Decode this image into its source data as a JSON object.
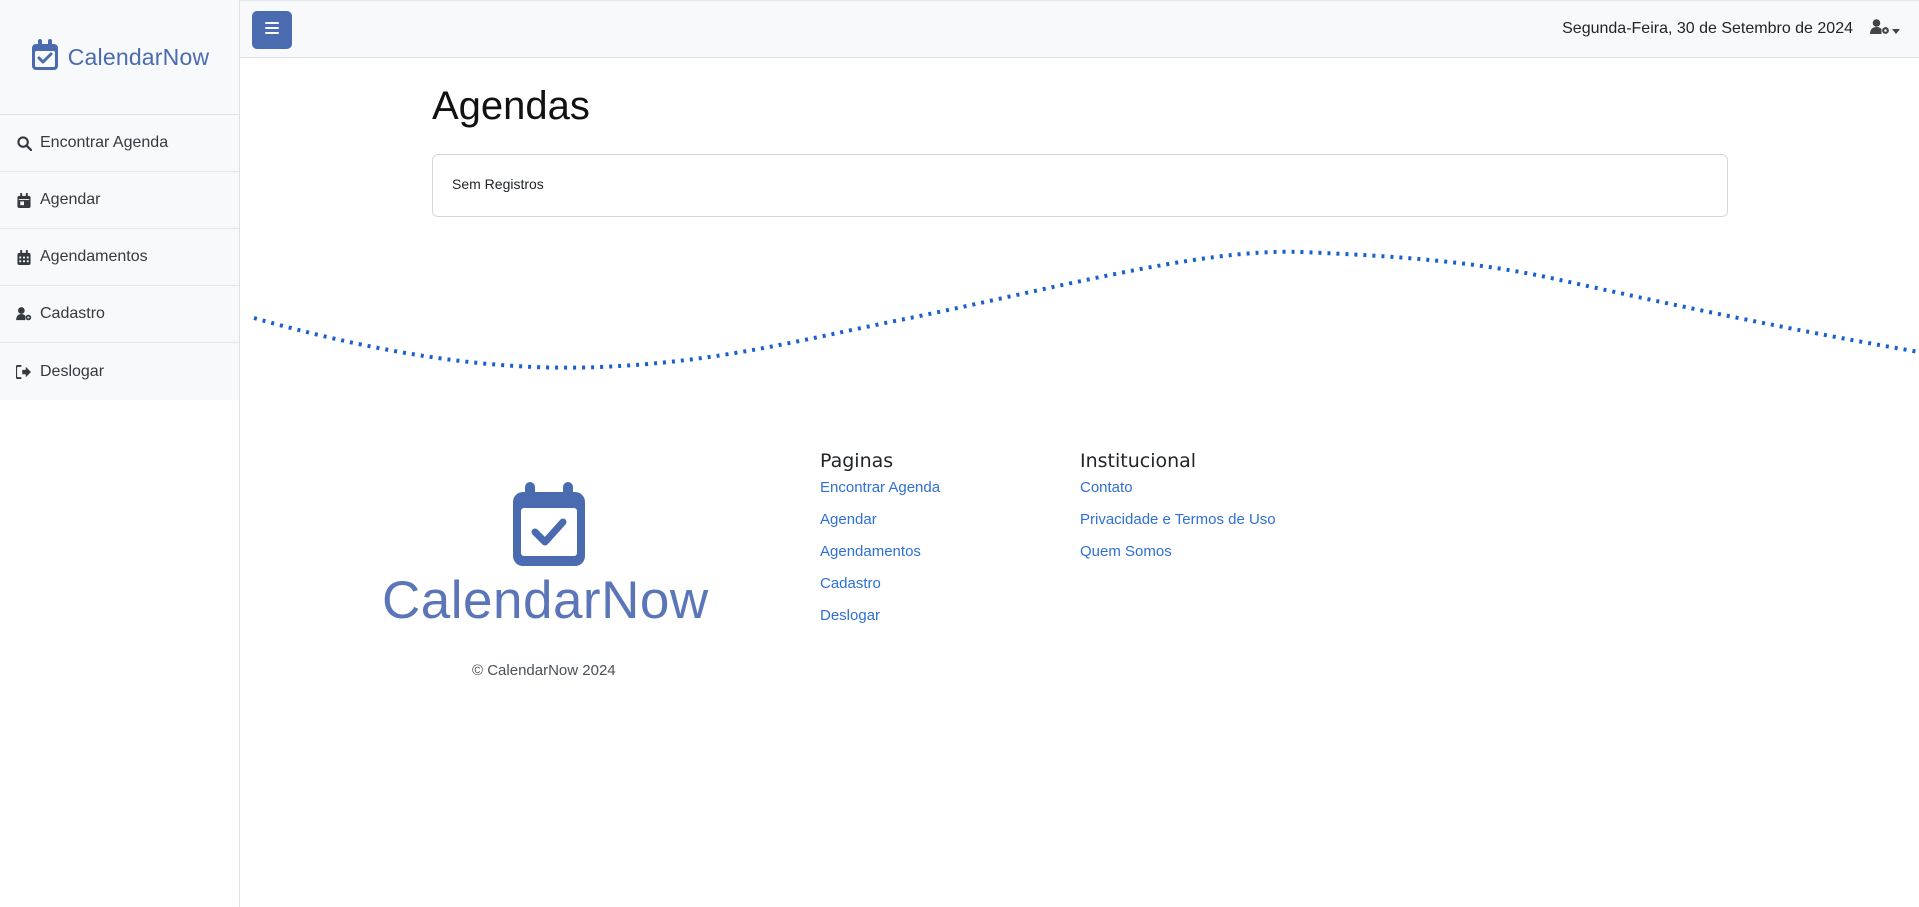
{
  "brand": {
    "name": "CalendarNow"
  },
  "sidebar": {
    "items": [
      {
        "label": "Encontrar Agenda",
        "icon": "search-icon"
      },
      {
        "label": "Agendar",
        "icon": "calendar-day-icon"
      },
      {
        "label": "Agendamentos",
        "icon": "calendar-grid-icon"
      },
      {
        "label": "Cadastro",
        "icon": "user-gear-icon"
      },
      {
        "label": "Deslogar",
        "icon": "logout-icon"
      }
    ]
  },
  "topbar": {
    "date": "Segunda-Feira, 30 de Setembro de 2024",
    "menu_icon": "hamburger-icon",
    "user_icon": "user-gear-icon"
  },
  "main": {
    "title": "Agendas",
    "empty_message": "Sem Registros"
  },
  "footer": {
    "logo_text": "CalendarNow",
    "copyright": "© CalendarNow 2024",
    "paginas": {
      "heading": "Paginas",
      "links": [
        "Encontrar Agenda",
        "Agendar",
        "Agendamentos",
        "Cadastro",
        "Deslogar"
      ]
    },
    "institucional": {
      "heading": "Institucional",
      "links": [
        "Contato",
        "Privacidade e Termos de Uso",
        "Quem Somos"
      ]
    }
  },
  "colors": {
    "brand": "#4a6bb0",
    "link": "#2f6fd6",
    "wave": "#1a5fd0",
    "sidebar_bg": "#f8f9fa"
  }
}
